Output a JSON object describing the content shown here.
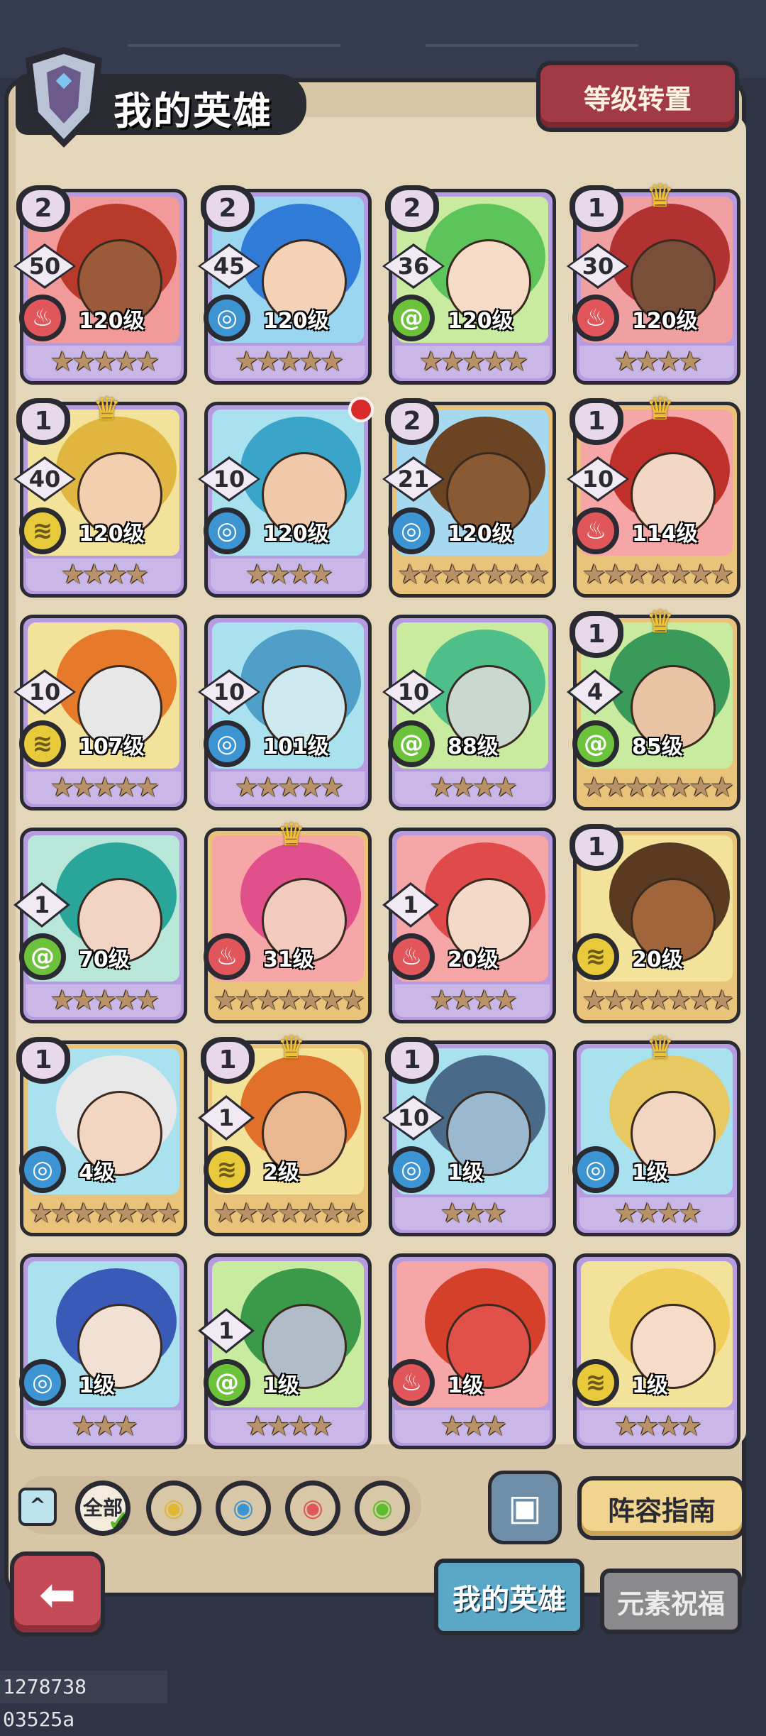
{
  "header": {
    "title": "我的英雄",
    "transfer_button": "等级转置"
  },
  "heroes": [
    {
      "rank": "2",
      "count": "50",
      "element": "fire",
      "level": "120级",
      "stars": 5,
      "crown": false,
      "frame": "purple",
      "skin": "#9b5a3a",
      "hair": "#b73a2b",
      "bg": "#f29a9a"
    },
    {
      "rank": "2",
      "count": "45",
      "element": "water",
      "level": "120级",
      "stars": 5,
      "crown": false,
      "frame": "purple",
      "skin": "#f3d2b8",
      "hair": "#2f7bd6",
      "bg": "#9bd6f0"
    },
    {
      "rank": "2",
      "count": "36",
      "element": "wind",
      "level": "120级",
      "stars": 5,
      "crown": false,
      "frame": "purple",
      "skin": "#f6dcc6",
      "hair": "#5cc45a",
      "bg": "#c8eba0"
    },
    {
      "rank": "1",
      "count": "30",
      "element": "fire",
      "level": "120级",
      "stars": 4,
      "crown": true,
      "frame": "purple",
      "skin": "#7a4f3a",
      "hair": "#b23232",
      "bg": "#f0a0a0"
    },
    {
      "rank": "1",
      "count": "40",
      "element": "earth",
      "level": "120级",
      "stars": 4,
      "crown": true,
      "frame": "purple",
      "skin": "#f2cfae",
      "hair": "#e0b640",
      "bg": "#f3e39a"
    },
    {
      "rank": "",
      "count": "10",
      "element": "water",
      "level": "120级",
      "stars": 4,
      "crown": false,
      "frame": "purple",
      "skin": "#f0c9aa",
      "hair": "#3aa5c8",
      "bg": "#a9e1ef",
      "reddot": true
    },
    {
      "rank": "2",
      "count": "21",
      "element": "water",
      "level": "120级",
      "stars": 7,
      "crown": false,
      "frame": "gold",
      "skin": "#8a5a34",
      "hair": "#6b4424",
      "bg": "#a6d8ef"
    },
    {
      "rank": "1",
      "count": "10",
      "element": "fire",
      "level": "114级",
      "stars": 7,
      "crown": true,
      "frame": "gold",
      "skin": "#f4d6c4",
      "hair": "#c0302a",
      "bg": "#f6a6a6"
    },
    {
      "rank": "",
      "count": "10",
      "element": "earth",
      "level": "107级",
      "stars": 5,
      "crown": false,
      "frame": "purple",
      "skin": "#e7e7e7",
      "hair": "#e67a2a",
      "bg": "#f3e39a"
    },
    {
      "rank": "",
      "count": "10",
      "element": "water",
      "level": "101级",
      "stars": 5,
      "crown": false,
      "frame": "purple",
      "skin": "#cfe9f0",
      "hair": "#4f9fc8",
      "bg": "#a9e1ef"
    },
    {
      "rank": "",
      "count": "10",
      "element": "wind",
      "level": "88级",
      "stars": 4,
      "crown": false,
      "frame": "purple",
      "skin": "#c9d9d0",
      "hair": "#4fbf8a",
      "bg": "#c8eba0"
    },
    {
      "rank": "1",
      "count": "4",
      "element": "wind",
      "level": "85级",
      "stars": 7,
      "crown": true,
      "frame": "gold",
      "skin": "#e8c4a4",
      "hair": "#3a9a5a",
      "bg": "#c8eba0"
    },
    {
      "rank": "",
      "count": "1",
      "element": "wind",
      "level": "70级",
      "stars": 5,
      "crown": false,
      "frame": "purple",
      "skin": "#f2d4c4",
      "hair": "#2aa59a",
      "bg": "#b8e6d8"
    },
    {
      "rank": "",
      "count": "",
      "element": "fire",
      "level": "31级",
      "stars": 7,
      "crown": true,
      "frame": "gold",
      "skin": "#f2cbbe",
      "hair": "#e0508a",
      "bg": "#f6a6a6"
    },
    {
      "rank": "",
      "count": "1",
      "element": "fire",
      "level": "20级",
      "stars": 4,
      "crown": false,
      "frame": "purple",
      "skin": "#f4d8c8",
      "hair": "#e04a4a",
      "bg": "#f6a6a6"
    },
    {
      "rank": "1",
      "count": "",
      "element": "earth",
      "level": "20级",
      "stars": 7,
      "crown": false,
      "frame": "gold",
      "skin": "#a0653a",
      "hair": "#5a3a20",
      "bg": "#f3e39a"
    },
    {
      "rank": "1",
      "count": "",
      "element": "water",
      "level": "4级",
      "stars": 7,
      "crown": false,
      "frame": "gold",
      "skin": "#f3d6c2",
      "hair": "#e8e8e8",
      "bg": "#a9e1ef"
    },
    {
      "rank": "1",
      "count": "1",
      "element": "earth",
      "level": "2级",
      "stars": 7,
      "crown": true,
      "frame": "gold",
      "skin": "#eab890",
      "hair": "#e0702a",
      "bg": "#f3e39a"
    },
    {
      "rank": "1",
      "count": "10",
      "element": "water",
      "level": "1级",
      "stars": 3,
      "crown": false,
      "frame": "purple",
      "skin": "#9ab8d0",
      "hair": "#4a6a8a",
      "bg": "#a9e1ef"
    },
    {
      "rank": "",
      "count": "",
      "element": "water",
      "level": "1级",
      "stars": 4,
      "crown": true,
      "frame": "purple",
      "skin": "#f3d6c2",
      "hair": "#e8c860",
      "bg": "#a9e1ef"
    },
    {
      "rank": "",
      "count": "",
      "element": "water",
      "level": "1级",
      "stars": 3,
      "crown": false,
      "frame": "purple",
      "skin": "#f3e0d4",
      "hair": "#3a5ab8",
      "bg": "#a9e1ef"
    },
    {
      "rank": "",
      "count": "1",
      "element": "wind",
      "level": "1级",
      "stars": 4,
      "crown": false,
      "frame": "purple",
      "skin": "#b0bcc8",
      "hair": "#3a9a4a",
      "bg": "#c8eba0"
    },
    {
      "rank": "",
      "count": "",
      "element": "fire",
      "level": "1级",
      "stars": 3,
      "crown": false,
      "frame": "purple",
      "skin": "#e2504a",
      "hair": "#d4402a",
      "bg": "#f6a6a6"
    },
    {
      "rank": "",
      "count": "",
      "element": "earth",
      "level": "1级",
      "stars": 4,
      "crown": false,
      "frame": "purple",
      "skin": "#f6dcc8",
      "hair": "#f0cc5a",
      "bg": "#f3e39a"
    }
  ],
  "filters": {
    "all_label": "全部",
    "elements": [
      "earth",
      "water",
      "fire",
      "wind"
    ]
  },
  "actions": {
    "guide_button": "阵容指南"
  },
  "tabs": {
    "heroes": "我的英雄",
    "blessing": "元素祝福"
  },
  "footer_id": "1278738 03525a",
  "colors": {
    "panel": "#d7c7a7",
    "accent_red": "#a23a46",
    "tab_active": "#5aa7c8"
  }
}
